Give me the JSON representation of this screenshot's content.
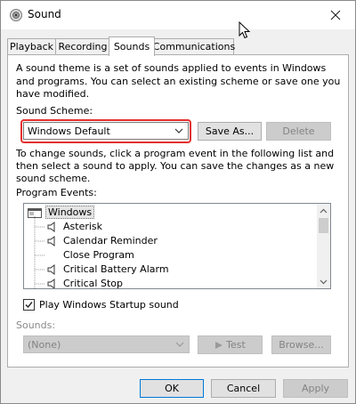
{
  "window": {
    "title": "Sound"
  },
  "tabs": [
    {
      "label": "Playback"
    },
    {
      "label": "Recording"
    },
    {
      "label": "Sounds"
    },
    {
      "label": "Communications"
    }
  ],
  "intro": {
    "line1": "A sound theme is a set of sounds applied to events in Windows",
    "line2": "and programs.  You can select an existing scheme or save one you",
    "line3": "have modified."
  },
  "scheme": {
    "label": "Sound Scheme:",
    "selected": "Windows Default",
    "save_as": "Save As...",
    "delete": "Delete"
  },
  "instructions": {
    "line1": "To change sounds, click a program event in the following list and",
    "line2": "then select a sound to apply.  You can save the changes as a new",
    "line3": "sound scheme."
  },
  "events": {
    "label": "Program Events:",
    "items": [
      {
        "label": "Windows",
        "icon": "windows-folder-icon"
      },
      {
        "label": "Asterisk",
        "icon": "speaker-icon"
      },
      {
        "label": "Calendar Reminder",
        "icon": "speaker-icon"
      },
      {
        "label": "Close Program",
        "icon": ""
      },
      {
        "label": "Critical Battery Alarm",
        "icon": "speaker-icon"
      },
      {
        "label": "Critical Stop",
        "icon": "speaker-icon"
      }
    ]
  },
  "startup": {
    "label": "Play Windows Startup sound",
    "checked": true
  },
  "sounds": {
    "label": "Sounds:",
    "selected": "(None)",
    "test": "Test",
    "browse": "Browse..."
  },
  "footer": {
    "ok": "OK",
    "cancel": "Cancel",
    "apply": "Apply"
  },
  "colors": {
    "highlight": "#e5302f",
    "default_button": "#0078d7"
  }
}
